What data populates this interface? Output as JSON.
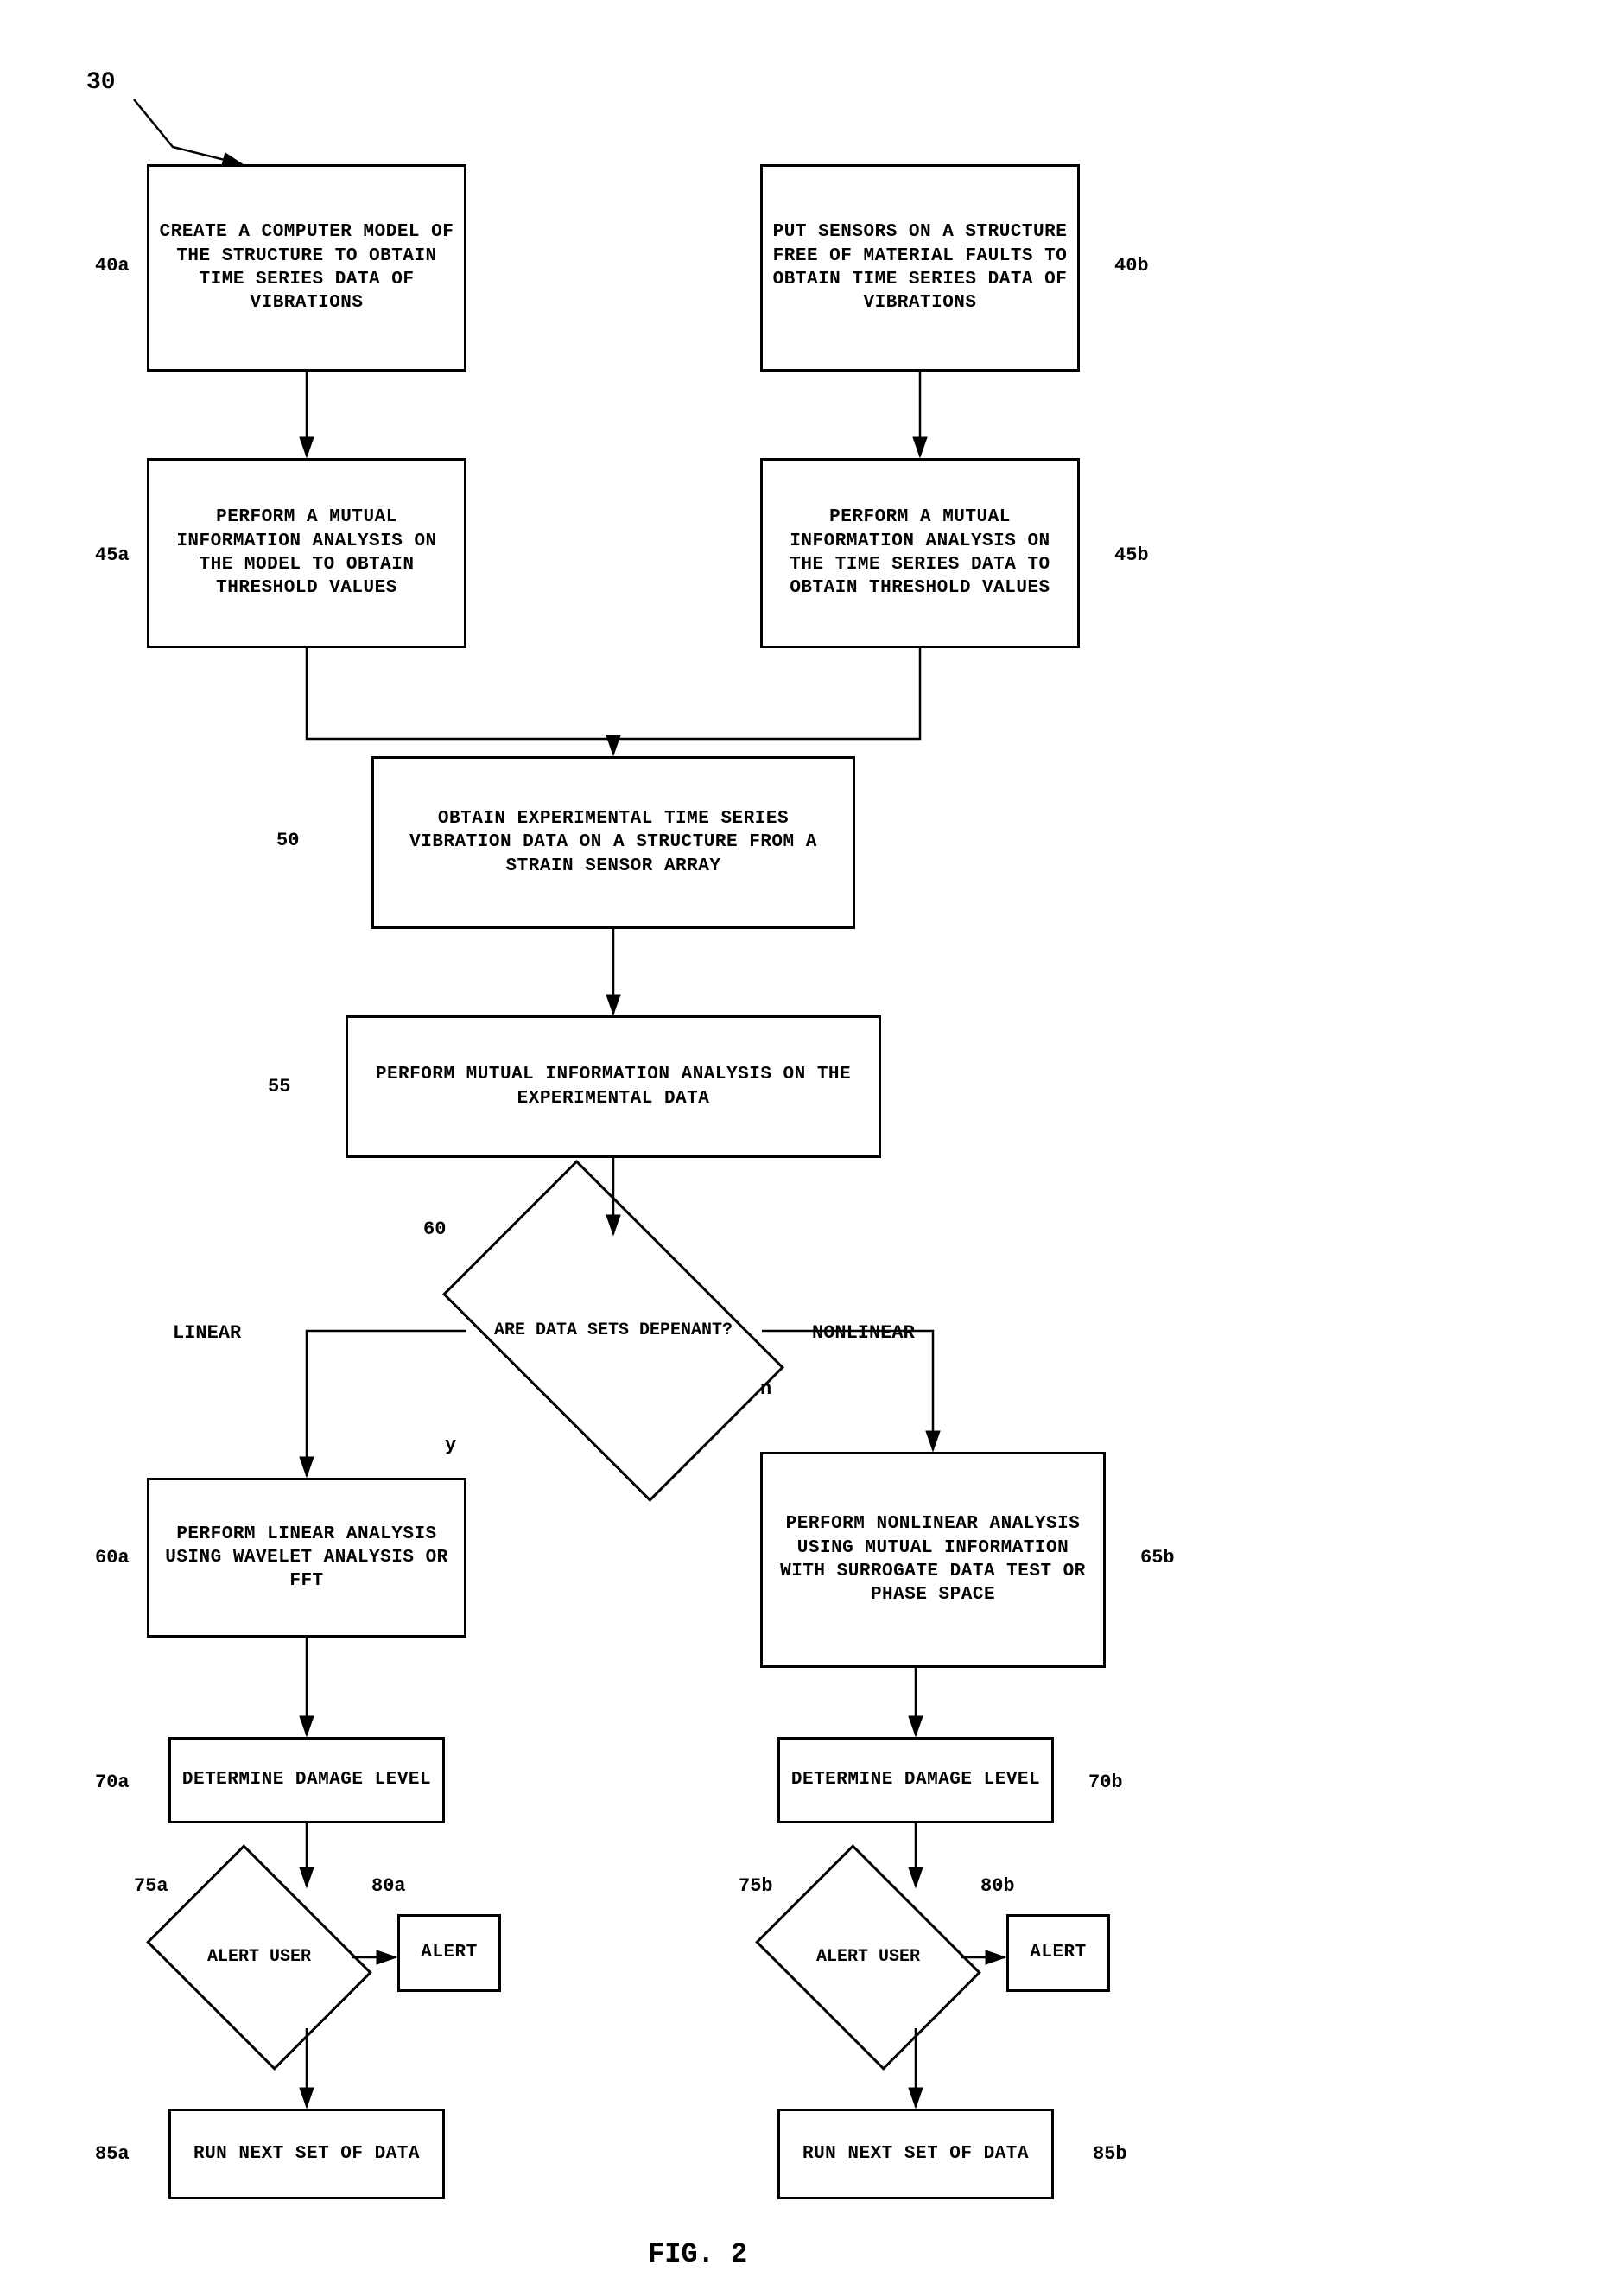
{
  "diagram": {
    "title": "FIG. 2",
    "diagram_number": "30",
    "nodes": {
      "node_40a_label": "40a",
      "node_40a_text": "CREATE A COMPUTER MODEL OF THE STRUCTURE TO OBTAIN TIME SERIES DATA OF VIBRATIONS",
      "node_40b_label": "40b",
      "node_40b_text": "PUT SENSORS ON A STRUCTURE FREE OF MATERIAL FAULTS TO OBTAIN TIME SERIES DATA OF VIBRATIONS",
      "node_45a_label": "45a",
      "node_45a_text": "PERFORM A MUTUAL INFORMATION ANALYSIS ON THE MODEL TO OBTAIN THRESHOLD VALUES",
      "node_45b_label": "45b",
      "node_45b_text": "PERFORM A MUTUAL INFORMATION ANALYSIS ON THE TIME SERIES DATA TO OBTAIN THRESHOLD VALUES",
      "node_50_label": "50",
      "node_50_text": "OBTAIN EXPERIMENTAL TIME SERIES VIBRATION DATA ON A STRUCTURE FROM A STRAIN SENSOR ARRAY",
      "node_55_label": "55",
      "node_55_text": "PERFORM MUTUAL INFORMATION ANALYSIS ON THE EXPERIMENTAL DATA",
      "node_60_label": "60",
      "node_60_text": "ARE DATA SETS DEPENANT?",
      "node_60_linear": "LINEAR",
      "node_60_nonlinear": "NONLINEAR",
      "node_60_y": "y",
      "node_60_n": "n",
      "node_60a_label": "60a",
      "node_60a_text": "PERFORM LINEAR ANALYSIS USING WAVELET ANALYSIS OR FFT",
      "node_65b_label": "65b",
      "node_65b_text": "PERFORM NONLINEAR ANALYSIS USING MUTUAL INFORMATION WITH SURROGATE DATA TEST OR PHASE SPACE",
      "node_70a_label": "70a",
      "node_70a_text": "DETERMINE DAMAGE LEVEL",
      "node_70b_label": "70b",
      "node_70b_text": "DETERMINE DAMAGE LEVEL",
      "node_75a_label": "75a",
      "node_75a_text": "ALERT USER",
      "node_75b_label": "75b",
      "node_75b_text": "ALERT USER",
      "node_80a_label": "80a",
      "node_80a_text": "ALERT",
      "node_80b_label": "80b",
      "node_80b_text": "ALERT",
      "node_85a_label": "85a",
      "node_85a_text": "RUN NEXT SET OF DATA",
      "node_85b_label": "85b",
      "node_85b_text": "RUN NEXT SET OF DATA"
    }
  }
}
